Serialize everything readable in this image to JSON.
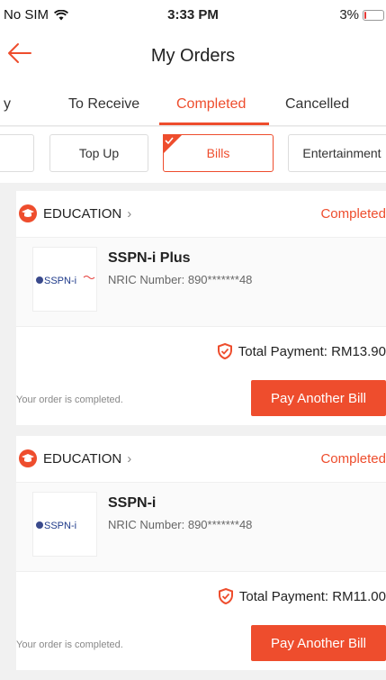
{
  "status_bar": {
    "carrier": "No SIM",
    "time": "3:33 PM",
    "battery": "3%"
  },
  "header": {
    "title": "My Orders"
  },
  "tabs": [
    {
      "label": "y"
    },
    {
      "label": "To Receive"
    },
    {
      "label": "Completed",
      "active": true
    },
    {
      "label": "Cancelled"
    }
  ],
  "chips": [
    {
      "label": "Top Up"
    },
    {
      "label": "Bills",
      "active": true
    },
    {
      "label": "Entertainment"
    }
  ],
  "orders": [
    {
      "category": "EDUCATION",
      "status": "Completed",
      "logo_text": "SSPN-i",
      "product": "SSPN-i Plus",
      "nric": "NRIC Number: 890*******48",
      "total": "Total Payment: RM13.90",
      "note": "Your order is completed.",
      "button": "Pay Another Bill"
    },
    {
      "category": "EDUCATION",
      "status": "Completed",
      "logo_text": "SSPN-i",
      "product": "SSPN-i",
      "nric": "NRIC Number: 890*******48",
      "total": "Total Payment: RM11.00",
      "note": "Your order is completed.",
      "button": "Pay Another Bill"
    }
  ],
  "colors": {
    "accent": "#ee4d2d"
  }
}
